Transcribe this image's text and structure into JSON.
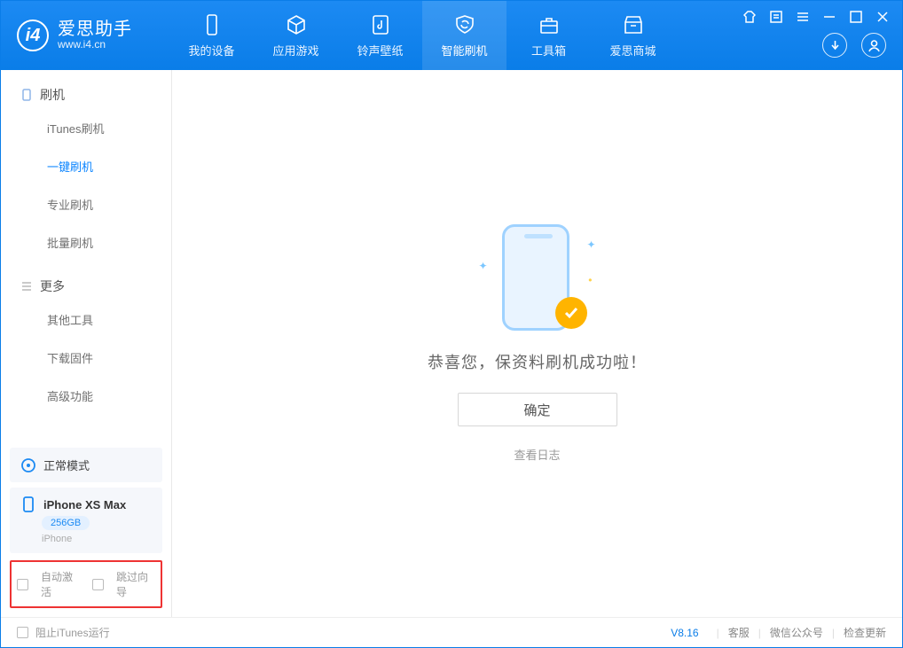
{
  "app": {
    "name_cn": "爱思助手",
    "name_en": "www.i4.cn"
  },
  "tabs": [
    {
      "key": "device",
      "label": "我的设备"
    },
    {
      "key": "apps",
      "label": "应用游戏"
    },
    {
      "key": "ring",
      "label": "铃声壁纸"
    },
    {
      "key": "flash",
      "label": "智能刷机",
      "active": true
    },
    {
      "key": "tools",
      "label": "工具箱"
    },
    {
      "key": "store",
      "label": "爱思商城"
    }
  ],
  "sidebar": {
    "section_flash": "刷机",
    "items_flash": [
      {
        "label": "iTunes刷机"
      },
      {
        "label": "一键刷机",
        "active": true
      },
      {
        "label": "专业刷机"
      },
      {
        "label": "批量刷机"
      }
    ],
    "section_more": "更多",
    "items_more": [
      {
        "label": "其他工具"
      },
      {
        "label": "下载固件"
      },
      {
        "label": "高级功能"
      }
    ],
    "mode": "正常模式",
    "device": {
      "name": "iPhone XS Max",
      "capacity": "256GB",
      "sub": "iPhone"
    },
    "opt_auto_activate": "自动激活",
    "opt_skip_guide": "跳过向导"
  },
  "main": {
    "message": "恭喜您，保资料刷机成功啦！",
    "ok": "确定",
    "view_log": "查看日志"
  },
  "footer": {
    "block_itunes": "阻止iTunes运行",
    "version": "V8.16",
    "support": "客服",
    "wechat": "微信公众号",
    "update": "检查更新"
  }
}
